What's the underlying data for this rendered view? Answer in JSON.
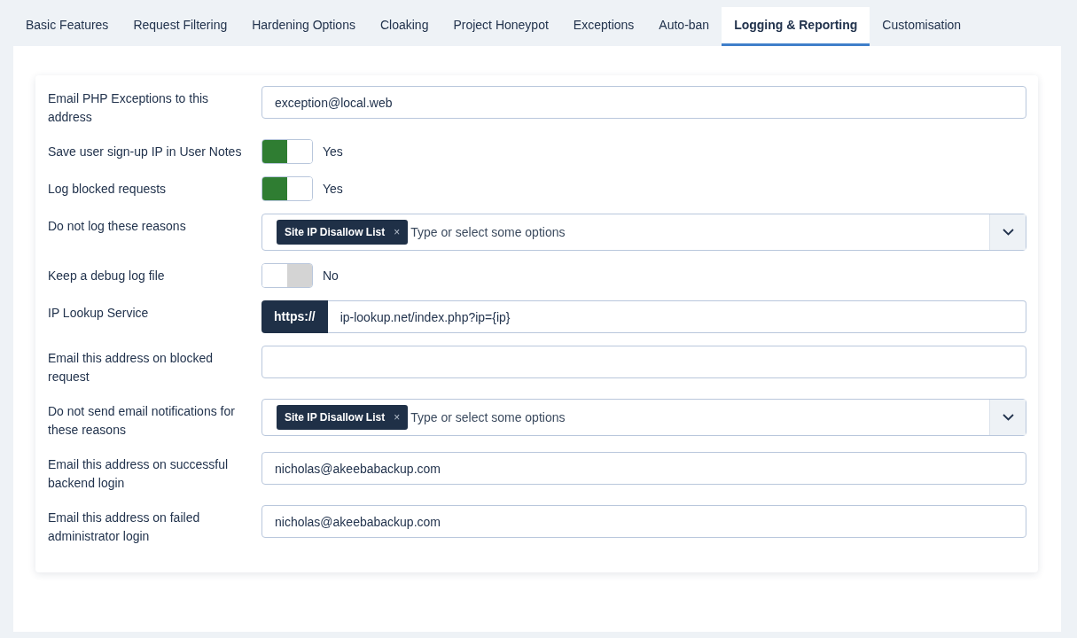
{
  "tabs": [
    {
      "label": "Basic Features",
      "selected": false
    },
    {
      "label": "Request Filtering",
      "selected": false
    },
    {
      "label": "Hardening Options",
      "selected": false
    },
    {
      "label": "Cloaking",
      "selected": false
    },
    {
      "label": "Project Honeypot",
      "selected": false
    },
    {
      "label": "Exceptions",
      "selected": false
    },
    {
      "label": "Auto-ban",
      "selected": false
    },
    {
      "label": "Logging & Reporting",
      "selected": true
    },
    {
      "label": "Customisation",
      "selected": false
    }
  ],
  "fields": [
    {
      "kind": "text",
      "label": "Email PHP Exceptions to this address",
      "value": "exception@local.web"
    },
    {
      "kind": "toggle",
      "label": "Save user sign-up IP in User Notes",
      "on": true,
      "state_text": "Yes"
    },
    {
      "kind": "toggle",
      "label": "Log blocked requests",
      "on": true,
      "state_text": "Yes"
    },
    {
      "kind": "multiselect",
      "label": "Do not log these reasons",
      "tags": [
        "Site IP Disallow List"
      ],
      "tag_remove": "×",
      "placeholder": "Type or select some options"
    },
    {
      "kind": "toggle",
      "label": "Keep a debug log file",
      "on": false,
      "state_text": "No"
    },
    {
      "kind": "prefixed",
      "label": "IP Lookup Service",
      "prefix": "https://",
      "value": "ip-lookup.net/index.php?ip={ip}"
    },
    {
      "kind": "text",
      "label": "Email this address on blocked request"
    },
    {
      "kind": "multiselect",
      "label": "Do not send email notifications for these reasons",
      "tags": [
        "Site IP Disallow List"
      ],
      "tag_remove": "×",
      "placeholder": "Type or select some options"
    },
    {
      "kind": "text",
      "label": "Email this address on successful backend login",
      "value": "nicholas@akeebabackup.com"
    },
    {
      "kind": "text",
      "label": "Email this address on failed administrator login",
      "value": "nicholas@akeebabackup.com"
    }
  ]
}
